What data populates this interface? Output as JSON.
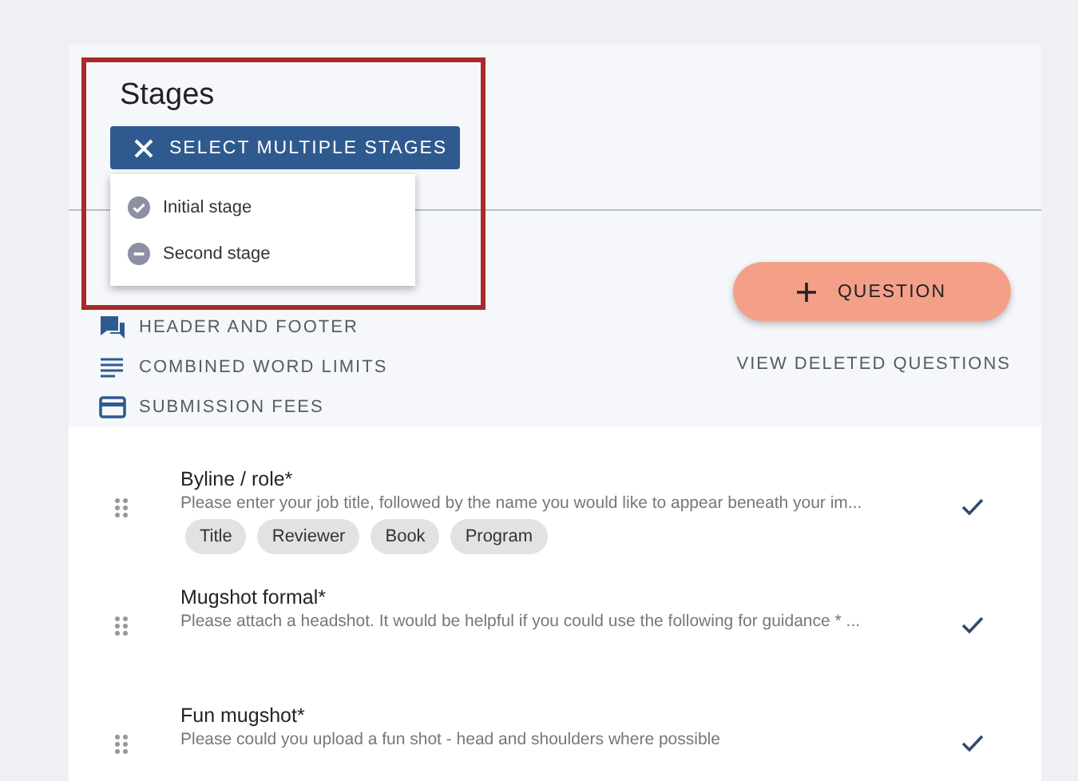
{
  "stages": {
    "title": "Stages",
    "button": "SELECT MULTIPLE STAGES",
    "options": [
      {
        "label": "Initial stage",
        "checked": true
      },
      {
        "label": "Second stage",
        "checked": false
      }
    ]
  },
  "menu": [
    {
      "label": "HEADER AND FOOTER",
      "kind": "chat"
    },
    {
      "label": "COMBINED WORD LIMITS",
      "kind": "lines"
    },
    {
      "label": "SUBMISSION FEES",
      "kind": "card"
    }
  ],
  "add_button": "QUESTION",
  "deleted_link": "VIEW DELETED QUESTIONS",
  "questions": [
    {
      "title": "Byline / role*",
      "description": "Please enter your job title, followed by the name you would like to appear beneath your im...",
      "tags": [
        "Title",
        "Reviewer",
        "Book",
        "Program"
      ]
    },
    {
      "title": "Mugshot formal*",
      "description": "Please attach a headshot. It would be helpful if you could use the following for guidance * ..."
    },
    {
      "title": "Fun mugshot*",
      "description": "Please could you upload a fun shot - head and shoulders where possible"
    }
  ]
}
